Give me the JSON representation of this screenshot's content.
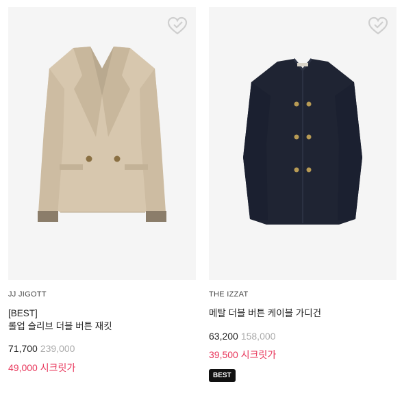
{
  "products": [
    {
      "brand": "JJ JIGOTT",
      "tag": "[BEST]",
      "name": "롤업 슬리브 더블 버튼 재킷",
      "sale_price": "71,700",
      "original_price": "239,000",
      "secret_price": "49,000 시크릿가",
      "image_icon": "beige-double-jacket",
      "accent_color": "#e8355a"
    },
    {
      "brand": "THE IZZAT",
      "name": "메탈 더블 버튼 케이블 가디건",
      "sale_price": "63,200",
      "original_price": "158,000",
      "secret_price": "39,500 시크릿가",
      "badge": "BEST",
      "image_icon": "navy-cable-cardigan",
      "accent_color": "#e8355a"
    }
  ]
}
